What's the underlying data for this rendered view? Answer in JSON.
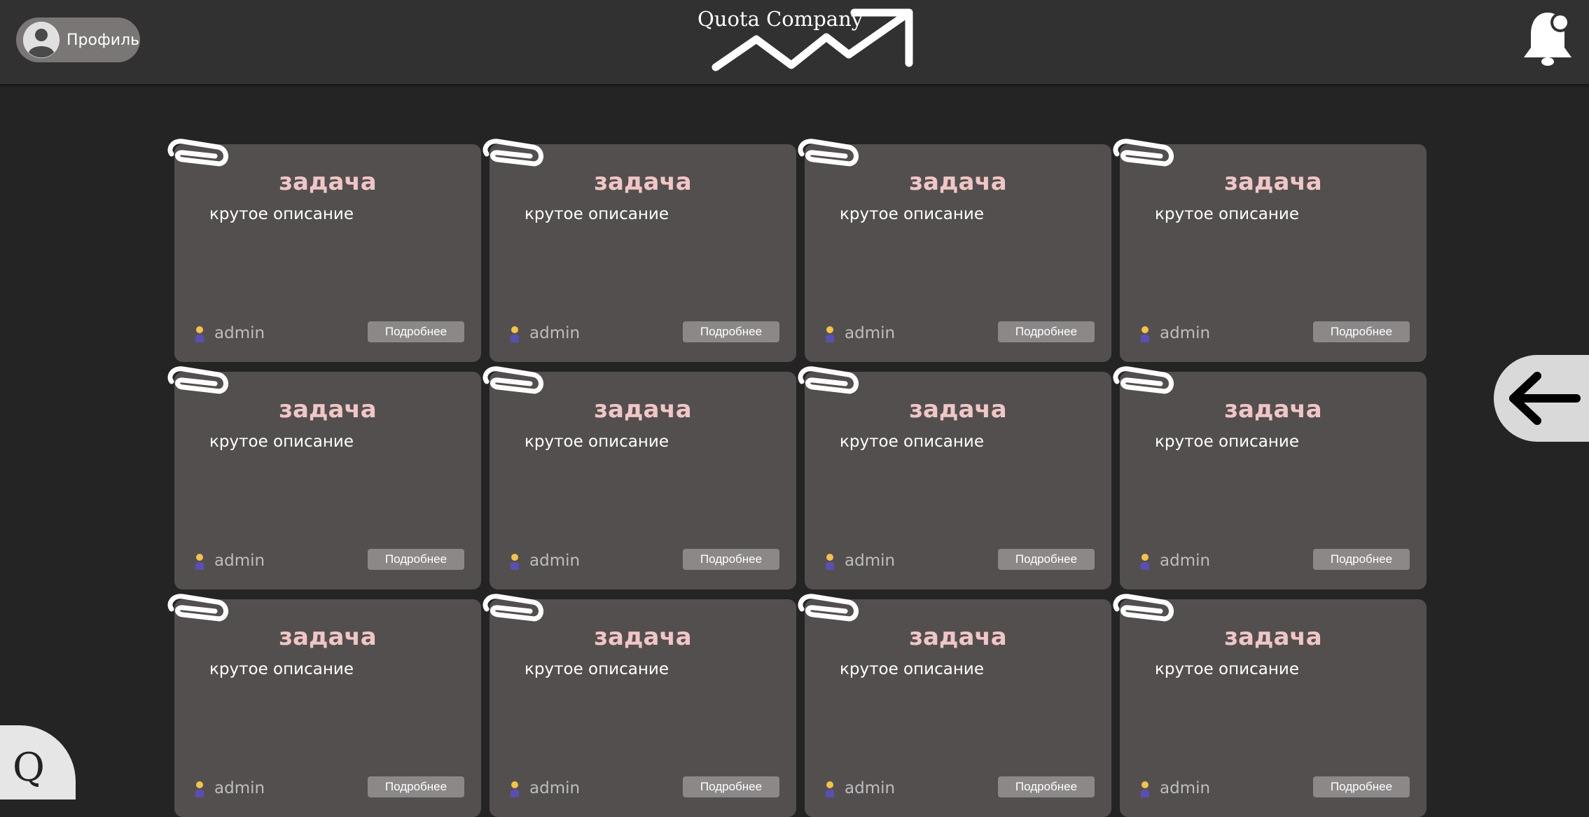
{
  "header": {
    "profile_label": "Профиль",
    "logo_text": "Quota Company"
  },
  "icons": {
    "profile": "user-avatar-icon",
    "logo": "trend-arrow-icon",
    "notifications": "bell-icon",
    "card_clip": "paperclip-icon",
    "author": "person-icon",
    "back": "arrow-left-icon",
    "brand": "q-logo-icon"
  },
  "colors": {
    "background": "#242424",
    "header": "#313131",
    "card": "#544f4f",
    "card_title": "#f0c6c6",
    "button": "#8c8888"
  },
  "cards": [
    {
      "title": "задача",
      "description": "крутое описание",
      "author": "admin",
      "button": "Подробнее"
    },
    {
      "title": "задача",
      "description": "крутое описание",
      "author": "admin",
      "button": "Подробнее"
    },
    {
      "title": "задача",
      "description": "крутое описание",
      "author": "admin",
      "button": "Подробнее"
    },
    {
      "title": "задача",
      "description": "крутое описание",
      "author": "admin",
      "button": "Подробнее"
    },
    {
      "title": "задача",
      "description": "крутое описание",
      "author": "admin",
      "button": "Подробнее"
    },
    {
      "title": "задача",
      "description": "крутое описание",
      "author": "admin",
      "button": "Подробнее"
    },
    {
      "title": "задача",
      "description": "крутое описание",
      "author": "admin",
      "button": "Подробнее"
    },
    {
      "title": "задача",
      "description": "крутое описание",
      "author": "admin",
      "button": "Подробнее"
    },
    {
      "title": "задача",
      "description": "крутое описание",
      "author": "admin",
      "button": "Подробнее"
    },
    {
      "title": "задача",
      "description": "крутое описание",
      "author": "admin",
      "button": "Подробнее"
    },
    {
      "title": "задача",
      "description": "крутое описание",
      "author": "admin",
      "button": "Подробнее"
    },
    {
      "title": "задача",
      "description": "крутое описание",
      "author": "admin",
      "button": "Подробнее"
    }
  ],
  "brand_button": {
    "letter": "Q"
  }
}
